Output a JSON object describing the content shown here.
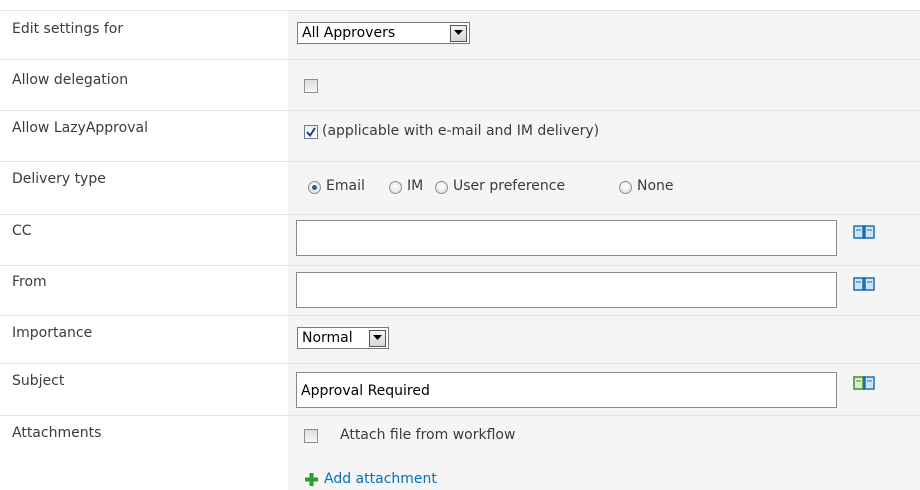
{
  "rows": {
    "edit_settings": {
      "label": "Edit settings for",
      "select_value": "All Approvers"
    },
    "allow_delegation": {
      "label": "Allow delegation",
      "checked": false
    },
    "allow_lazy": {
      "label": "Allow LazyApproval",
      "checked": true,
      "note": "(applicable with e-mail and IM delivery)"
    },
    "delivery_type": {
      "label": "Delivery type",
      "options": [
        "Email",
        "IM",
        "User preference",
        "None"
      ],
      "selected": "Email"
    },
    "cc": {
      "label": "CC",
      "value": ""
    },
    "from": {
      "label": "From",
      "value": ""
    },
    "importance": {
      "label": "Importance",
      "select_value": "Normal"
    },
    "subject": {
      "label": "Subject",
      "value": "Approval Required"
    },
    "attachments": {
      "label": "Attachments",
      "checkbox_label": "Attach file from workflow",
      "checked": false,
      "add_link": "Add attachment"
    }
  },
  "icons": {
    "address_book": "address-book-icon",
    "address_book_color": "#1f6fb5",
    "address_book_subject_color": "#3d8f2e",
    "plus_color": "#2e9b2e"
  },
  "colors": {
    "value_column_bg": "#f5f5f5",
    "link": "#0072bc",
    "text": "#3b3b3b"
  }
}
